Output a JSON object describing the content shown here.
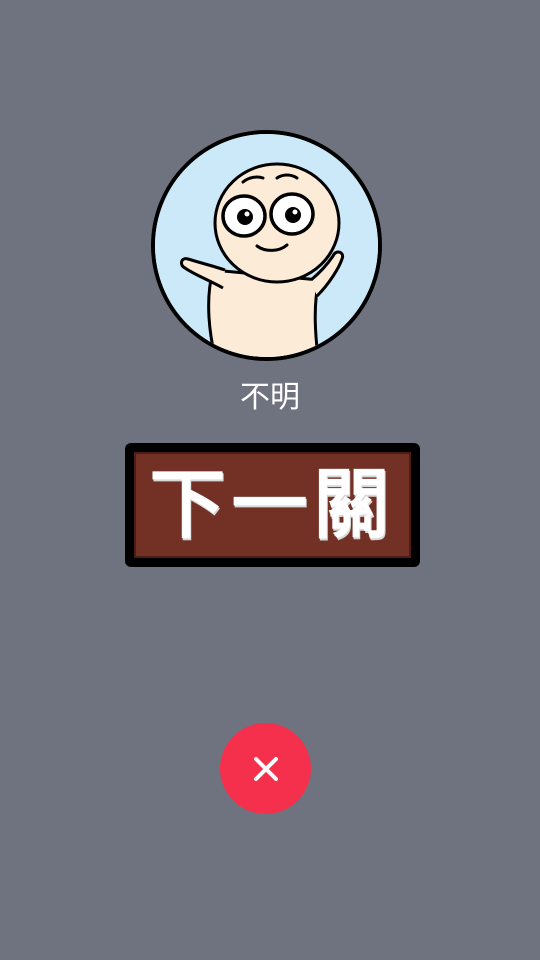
{
  "call": {
    "caller_name": "不明",
    "next_level_label": "下一關",
    "decline_icon": "close-icon"
  },
  "colors": {
    "background": "#6e737f",
    "avatar_background": "#cbe9f8",
    "next_level_fill": "#733126",
    "decline_button": "#f5304d"
  }
}
